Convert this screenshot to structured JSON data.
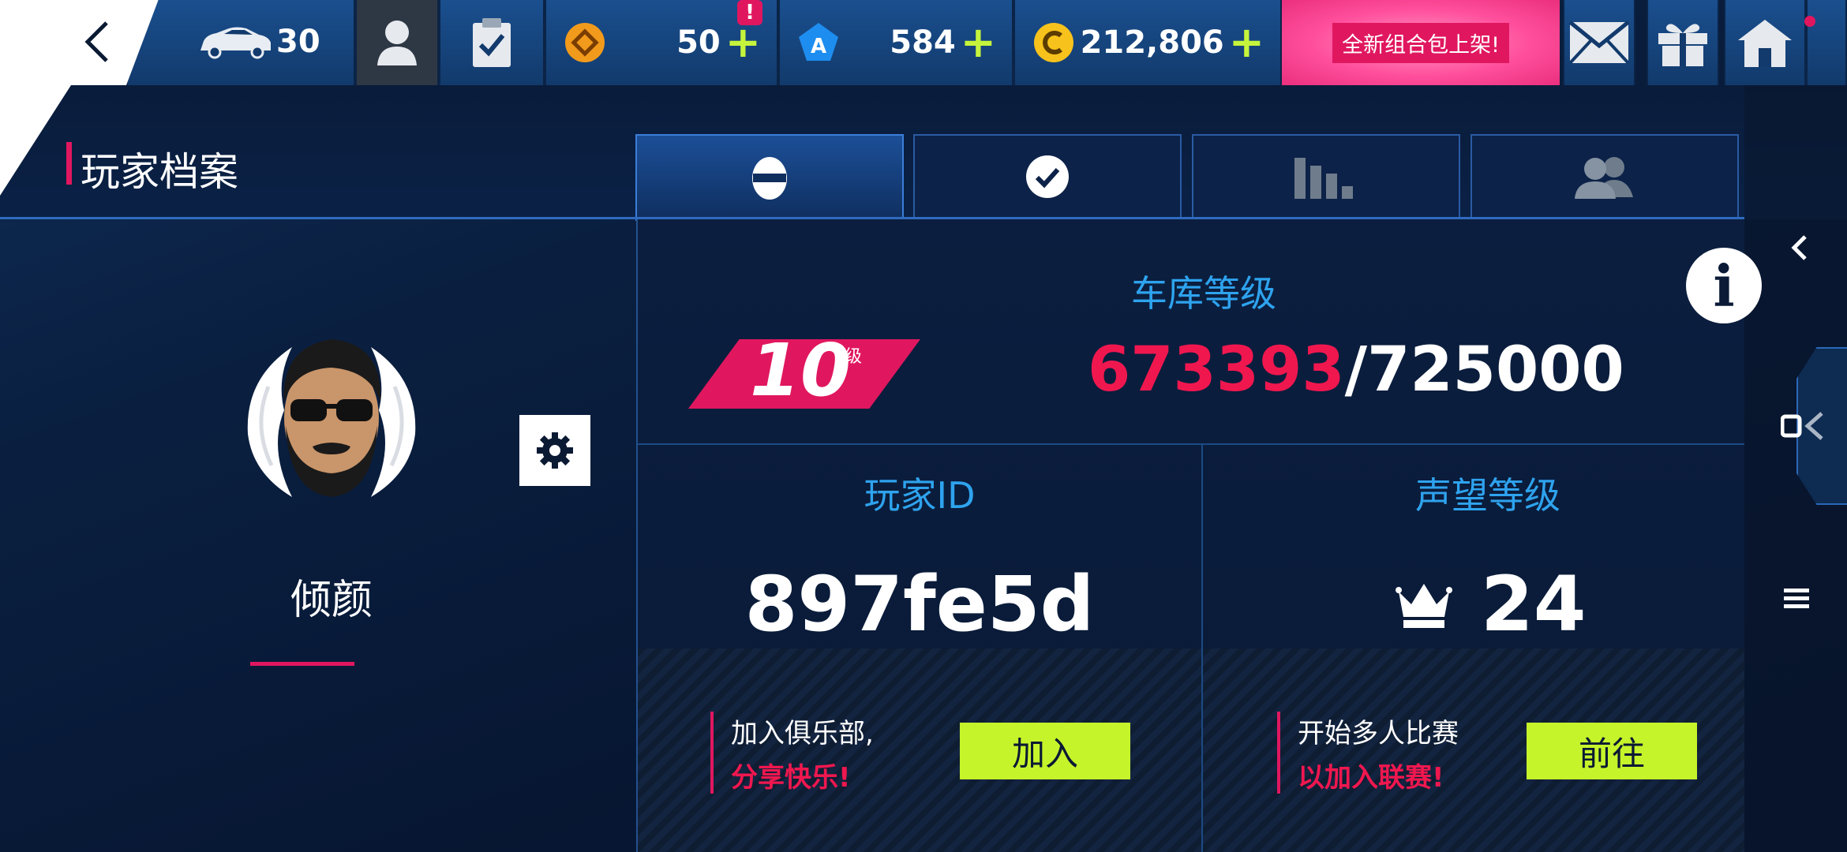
{
  "topbar": {
    "cars_count": "30",
    "currency1_value": "50",
    "currency1_alert": "!",
    "currency2_value": "584",
    "currency3_value": "212,806",
    "plus": "+",
    "promo_text": "全新组合包上架!"
  },
  "page": {
    "title": "玩家档案"
  },
  "tabs": [
    {
      "icon": "helmet-icon",
      "active": true
    },
    {
      "icon": "checkmark-icon",
      "active": false
    },
    {
      "icon": "bar-chart-icon",
      "active": false
    },
    {
      "icon": "friends-icon",
      "active": false
    }
  ],
  "profile": {
    "name": "倾颜",
    "avatar": "bearded-man-avatar"
  },
  "garage": {
    "label": "车库等级",
    "level": "10",
    "level_suffix": "级",
    "xp_current": "673393",
    "xp_separator": "/",
    "xp_max": "725000"
  },
  "player_id": {
    "label": "玩家ID",
    "value": "897fe5d"
  },
  "prestige": {
    "label": "声望等级",
    "value": "24"
  },
  "club_cta": {
    "line1": "加入俱乐部,",
    "line2": "分享快乐!",
    "button": "加入"
  },
  "multiplayer_cta": {
    "line1": "开始多人比赛",
    "line2": "以加入联赛!",
    "button": "前往"
  },
  "info": {
    "label": "i"
  },
  "colors": {
    "accent_pink": "#e0175f",
    "accent_lime": "#c6f42a",
    "label_blue": "#2ea3ee",
    "xp_red": "#f0174f"
  }
}
